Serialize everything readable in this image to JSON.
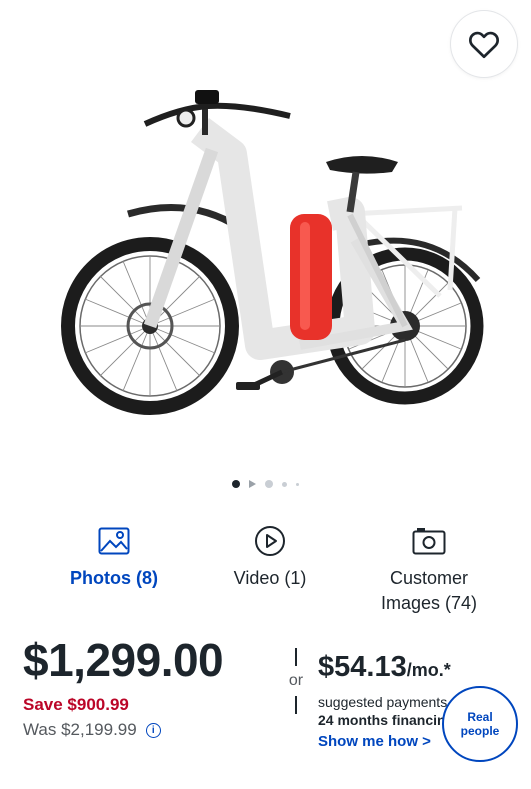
{
  "media_tabs": {
    "photos": "Photos (8)",
    "video": "Video (1)",
    "customer_line1": "Customer",
    "customer_line2": "Images (74)"
  },
  "pricing": {
    "price": "$1,299.00",
    "save": "Save $900.99",
    "was": "Was $2,199.99",
    "or": "or",
    "monthly_amount": "$54.13",
    "monthly_suffix": "/mo.*",
    "suggested": "suggested payments",
    "months": "24 months financing",
    "show_me_how": "Show me how >"
  },
  "real_people": "Real people",
  "colors": {
    "accent_blue": "#0046be",
    "sale_red": "#bb0628",
    "text": "#1d252c",
    "muted": "#55595e"
  },
  "carousel": {
    "current": 1,
    "total": 5
  },
  "icons": {
    "favorite": "heart-outline-icon",
    "photos": "image-icon",
    "video": "play-circle-icon",
    "customer": "camera-icon",
    "info": "info-icon"
  }
}
